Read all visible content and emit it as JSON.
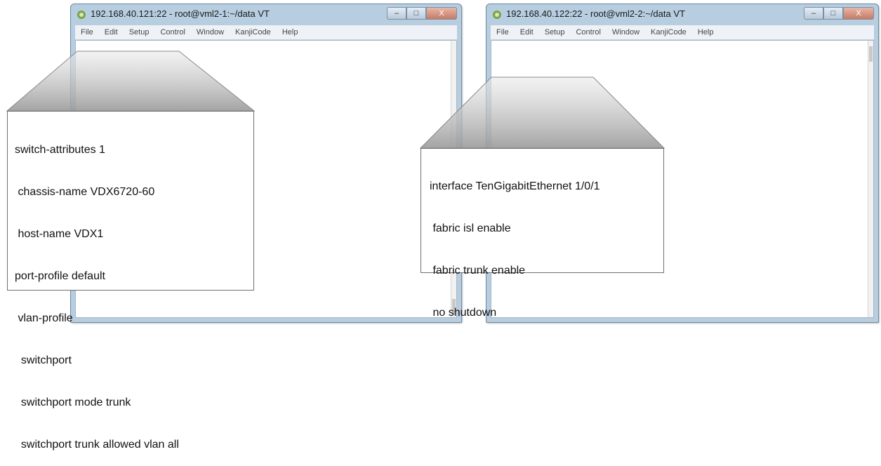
{
  "windows": {
    "left": {
      "title": "192.168.40.121:22 - root@vml2-1:~/data VT",
      "menu": [
        "File",
        "Edit",
        "Setup",
        "Control",
        "Window",
        "KanjiCode",
        "Help"
      ],
      "controls": {
        "minimize": "–",
        "maximize": "□",
        "close": "X"
      }
    },
    "right": {
      "title": "192.168.40.122:22 - root@vml2-2:~/data VT",
      "menu": [
        "File",
        "Edit",
        "Setup",
        "Control",
        "Window",
        "KanjiCode",
        "Help"
      ],
      "controls": {
        "minimize": "–",
        "maximize": "□",
        "close": "X"
      }
    }
  },
  "callouts": {
    "left": {
      "lines": [
        "switch-attributes 1",
        " chassis-name VDX6720-60",
        " host-name VDX1",
        "port-profile default",
        " vlan-profile",
        "  switchport",
        "  switchport mode trunk",
        "  switchport trunk allowed vlan all"
      ]
    },
    "right": {
      "lines": [
        "interface TenGigabitEthernet 1/0/1",
        " fabric isl enable",
        " fabric trunk enable",
        " no shutdown"
      ]
    }
  },
  "colors": {
    "window_frame": "#b7cde0",
    "callout_border": "#707070",
    "zoom_wedge": "#d9d9d9"
  }
}
